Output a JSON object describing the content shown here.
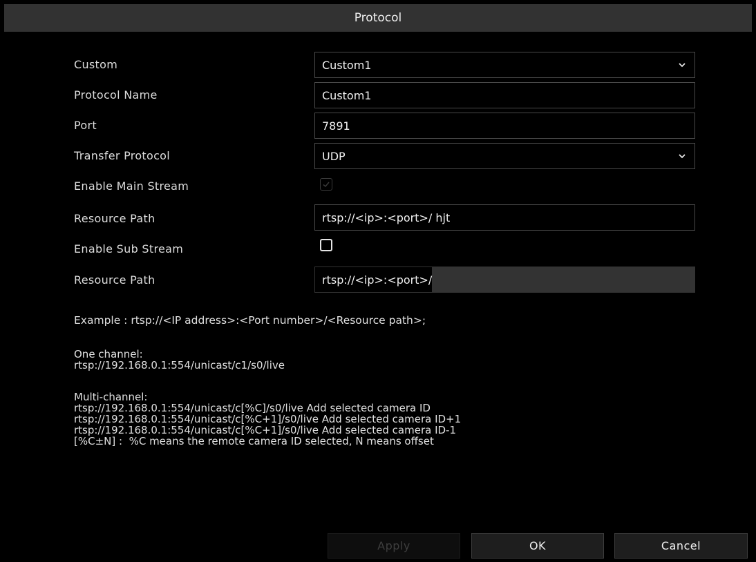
{
  "dialog": {
    "title": "Protocol"
  },
  "form": {
    "custom": {
      "label": "Custom",
      "value": "Custom1",
      "icon": "chevron-down-icon"
    },
    "protocol_name": {
      "label": "Protocol Name",
      "value": "Custom1"
    },
    "port": {
      "label": "Port",
      "value": "7891"
    },
    "transfer_protocol": {
      "label": "Transfer Protocol",
      "value": "UDP",
      "icon": "chevron-down-icon"
    },
    "enable_main_stream": {
      "label": "Enable Main Stream",
      "checked": true,
      "disabled": true
    },
    "main_resource_path": {
      "label": "Resource Path",
      "value": "rtsp://<ip>:<port>/ hjt"
    },
    "enable_sub_stream": {
      "label": "Enable Sub Stream",
      "checked": false
    },
    "sub_resource_path": {
      "label": "Resource Path",
      "value": "rtsp://<ip>:<port>/"
    }
  },
  "help": {
    "example": "Example : rtsp://<IP address>:<Port number>/<Resource path>;",
    "one_channel_title": "One channel:",
    "one_channel_line": "rtsp://192.168.0.1:554/unicast/c1/s0/live",
    "multi_channel_title": "Multi-channel:",
    "multi_channel_lines": [
      "rtsp://192.168.0.1:554/unicast/c[%C]/s0/live Add selected camera ID",
      "rtsp://192.168.0.1:554/unicast/c[%C+1]/s0/live Add selected camera ID+1",
      "rtsp://192.168.0.1:554/unicast/c[%C+1]/s0/live Add selected camera ID-1",
      "[%C±N] :  %C means the remote camera ID selected, N means offset"
    ]
  },
  "buttons": {
    "apply": "Apply",
    "ok": "OK",
    "cancel": "Cancel"
  },
  "colors": {
    "background": "#000000",
    "titlebar": "#323232",
    "field_border": "#4a4a4a",
    "button": "#1e1e1e"
  }
}
